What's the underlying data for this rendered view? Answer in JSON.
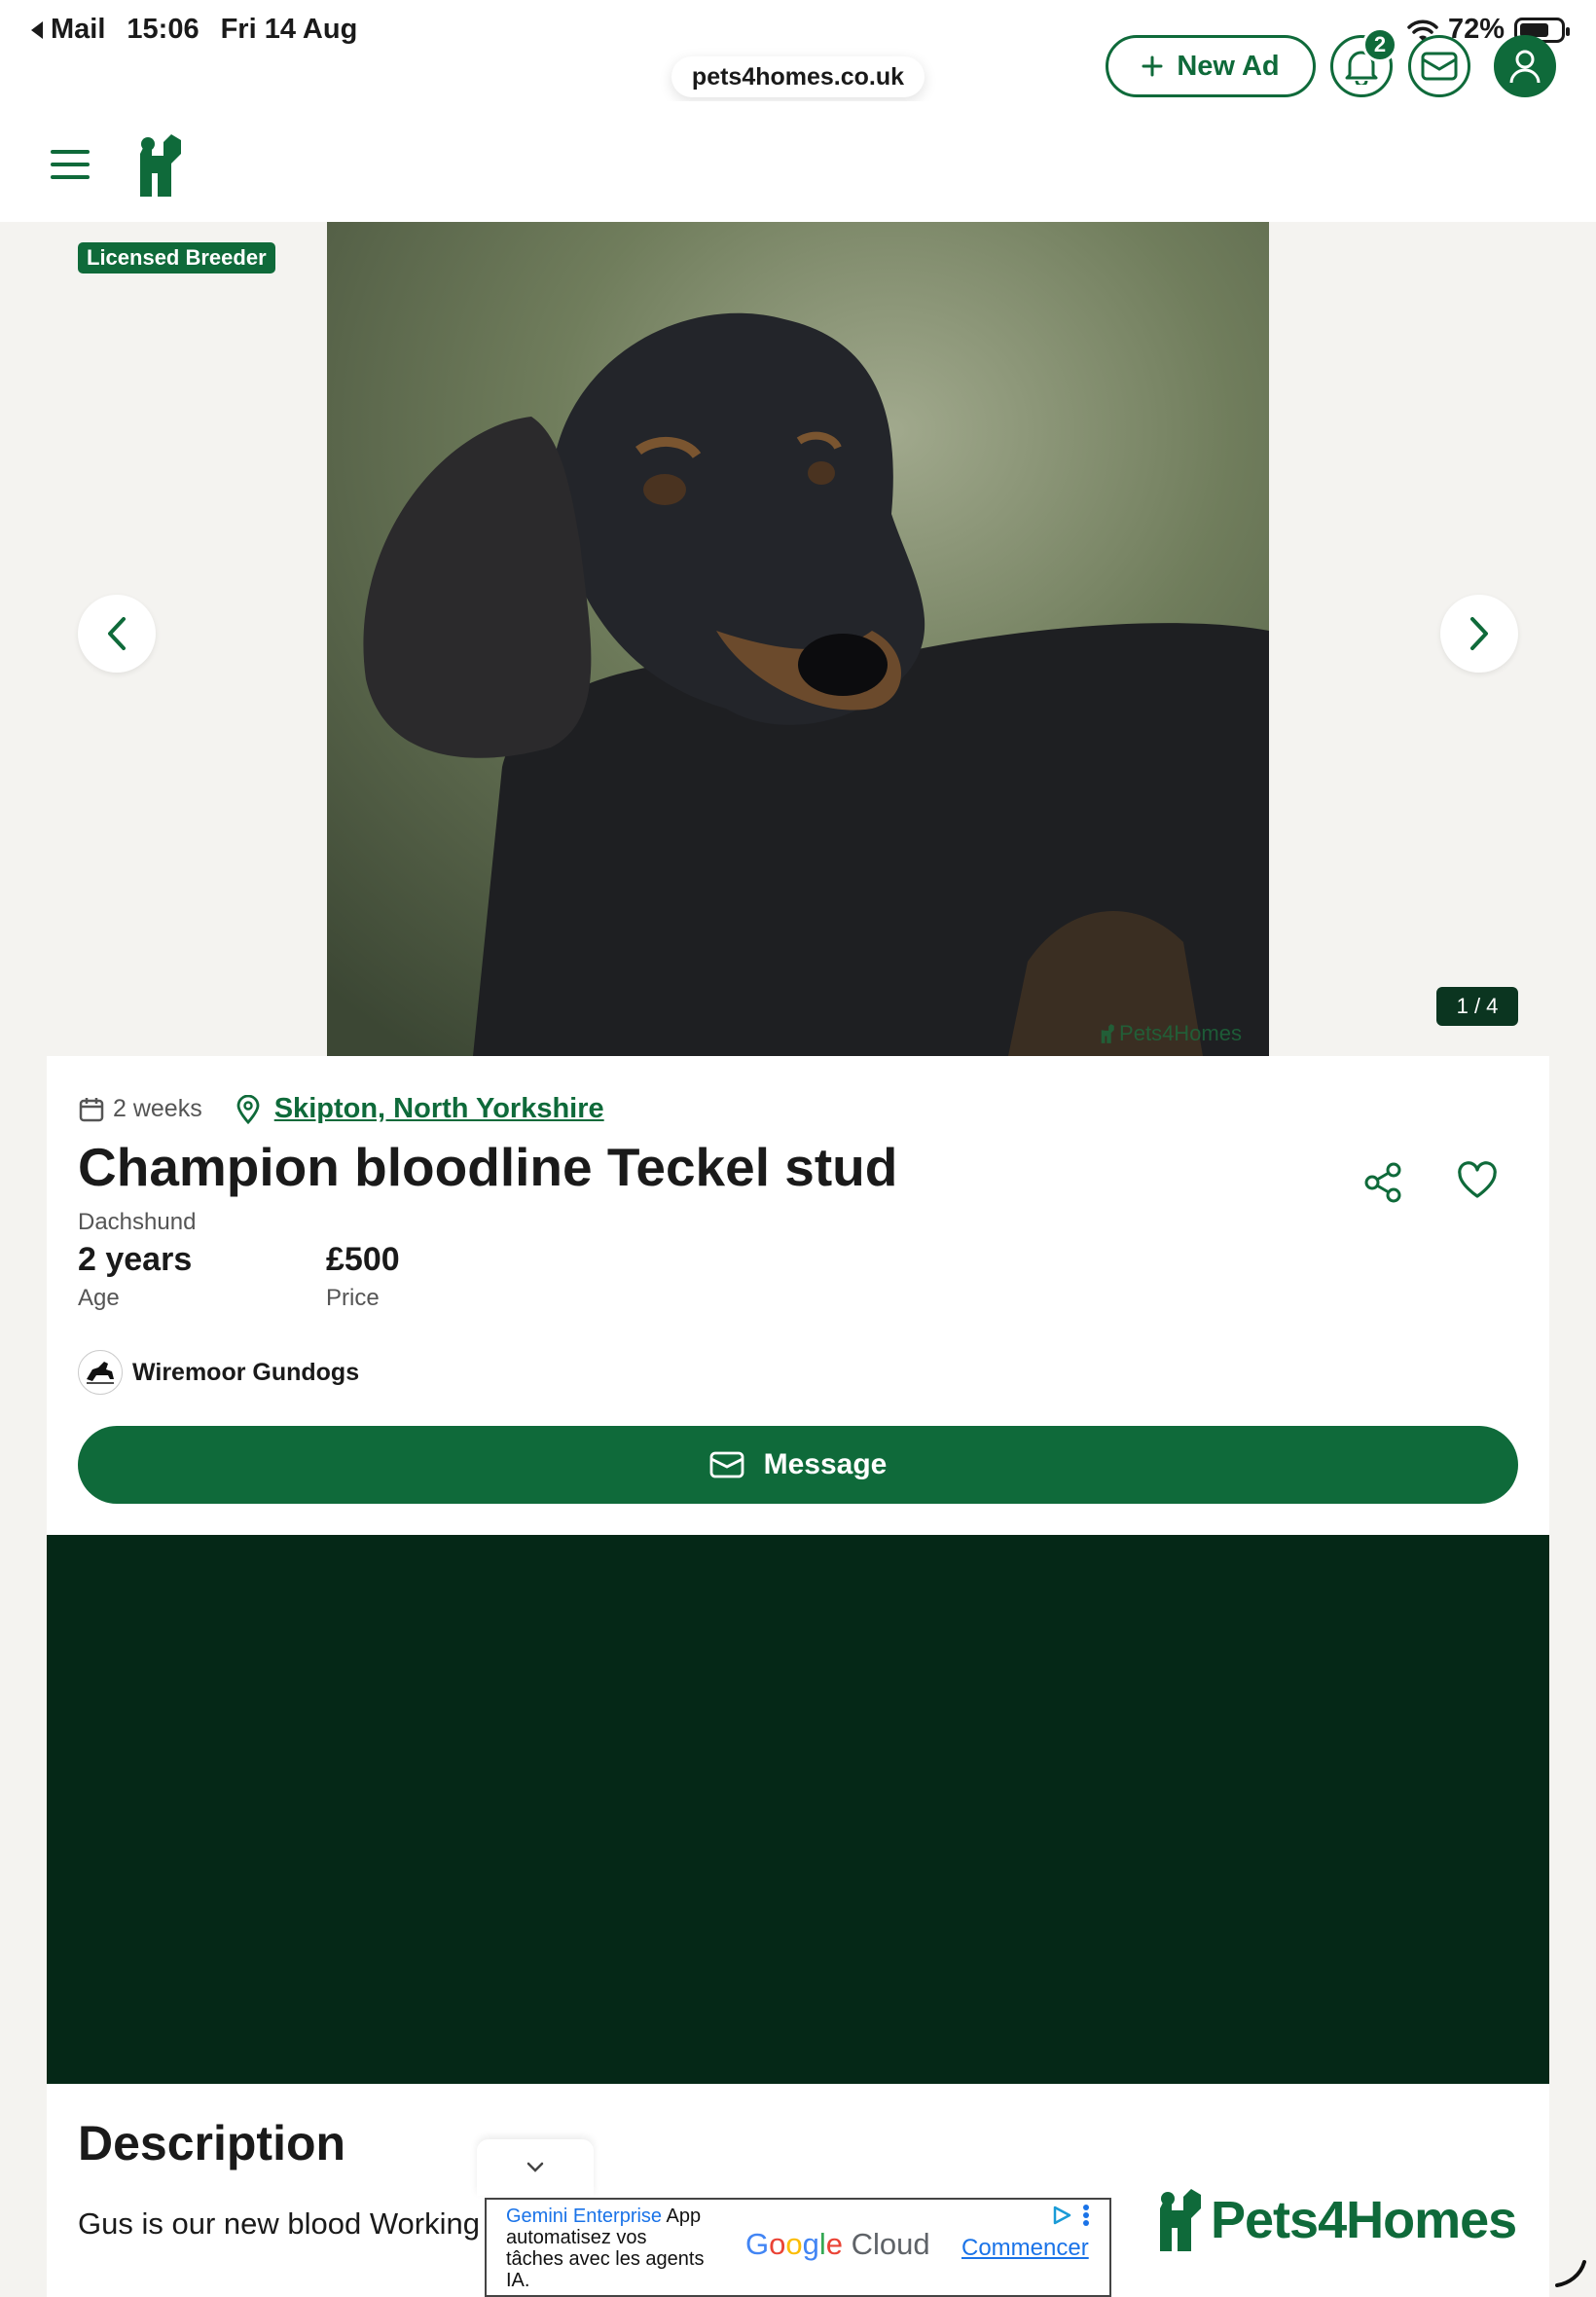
{
  "status_bar": {
    "back_app": "Mail",
    "time": "15:06",
    "date": "Fri 14 Aug",
    "battery": "72%",
    "battery_level": 0.72
  },
  "url_bar": {
    "domain": "pets4homes.co.uk"
  },
  "header": {
    "new_ad_label": "New Ad",
    "notification_count": "2"
  },
  "gallery": {
    "badge": "Licensed Breeder",
    "counter": "1 / 4",
    "watermark": "Pets4Homes"
  },
  "listing": {
    "posted": "2 weeks",
    "location": "Skipton, North Yorkshire",
    "title": "Champion bloodline Teckel stud",
    "breed": "Dachshund",
    "age_value": "2 years",
    "age_label": "Age",
    "price_value": "£500",
    "price_label": "Price",
    "seller_name": "Wiremoor Gundogs",
    "message_label": "Message"
  },
  "description": {
    "heading": "Description",
    "text": "Gus is our new blood Working"
  },
  "ad": {
    "line1_brand": "Gemini Enterprise",
    "line1_rest": "App",
    "line2": "automatisez vos",
    "line3": "tâches avec les agents",
    "line4": "IA.",
    "product": "Google Cloud",
    "cta": "Commencer"
  },
  "footer_logo": {
    "name": "Pets4Homes"
  },
  "colors": {
    "brand_green": "#0f6a3a",
    "dark_block": "#052817"
  }
}
